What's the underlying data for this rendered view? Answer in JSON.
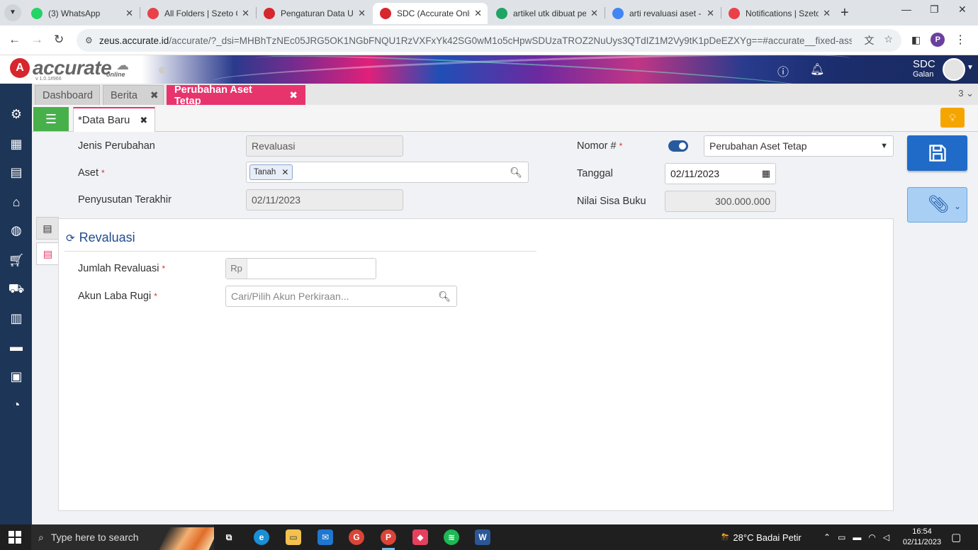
{
  "browser": {
    "tabs": [
      {
        "title": "(3) WhatsApp",
        "favicon": "whatsapp-icon",
        "color": "#25d366"
      },
      {
        "title": "All Folders | Szeto C",
        "favicon": "szeto-icon",
        "color": "#e9414a"
      },
      {
        "title": "Pengaturan Data Us",
        "favicon": "accurate-icon",
        "color": "#d7262e"
      },
      {
        "title": "SDC (Accurate Onlin",
        "favicon": "accurate-icon",
        "color": "#d7262e"
      },
      {
        "title": "artikel utk dibuat pe",
        "favicon": "sheets-icon",
        "color": "#1fa463"
      },
      {
        "title": "arti revaluasi aset - ",
        "favicon": "google-icon",
        "color": "#4285f4"
      },
      {
        "title": "Notifications | Szeto",
        "favicon": "szeto-icon",
        "color": "#e9414a"
      }
    ],
    "close_glyph": "✕",
    "url_host": "zeus.accurate.id",
    "url_rest": "/accurate/?_dsi=MHBhTzNEc05JRG5OK1NGbFNQU1RzVXFxYk42SG0wM1o5cHpwSDUzaTROZ2NuUys3QTdIZ1M2Vy9tK1pDeEZXYg==#accurate__fixed-asset__fixed-asset-edited",
    "profile_initial": "P"
  },
  "app": {
    "logo_text": "accurate",
    "logo_sub": "online",
    "version": "v 1.0.1#966",
    "user_name": "SDC",
    "user_sub": "Galan"
  },
  "module_tabs": [
    {
      "label": "Dashboard",
      "closable": false
    },
    {
      "label": "Berita",
      "closable": true
    },
    {
      "label": "Perubahan Aset Tetap",
      "closable": true
    }
  ],
  "module_tab_count": "3",
  "subtab": {
    "label": "*Data Baru",
    "close": "✖"
  },
  "form": {
    "jenis_perubahan_label": "Jenis Perubahan",
    "jenis_perubahan_value": "Revaluasi",
    "aset_label": "Aset",
    "aset_chip": "Tanah",
    "penyusutan_label": "Penyusutan Terakhir",
    "penyusutan_value": "02/11/2023",
    "nomor_label": "Nomor #",
    "nomor_select": "Perubahan Aset Tetap",
    "tanggal_label": "Tanggal",
    "tanggal_value": "02/11/2023",
    "nilai_label": "Nilai Sisa Buku",
    "nilai_value": "300.000.000",
    "required_mark": "*"
  },
  "panel": {
    "title": "Revaluasi",
    "jumlah_label": "Jumlah Revaluasi",
    "currency": "Rp",
    "jumlah_value": "",
    "akun_label": "Akun Laba Rugi",
    "akun_placeholder": "Cari/Pilih Akun Perkiraan..."
  },
  "taskbar": {
    "search_placeholder": "Type here to search",
    "weather": "28°C  Badai Petir",
    "time": "16:54",
    "date": "02/11/2023"
  }
}
